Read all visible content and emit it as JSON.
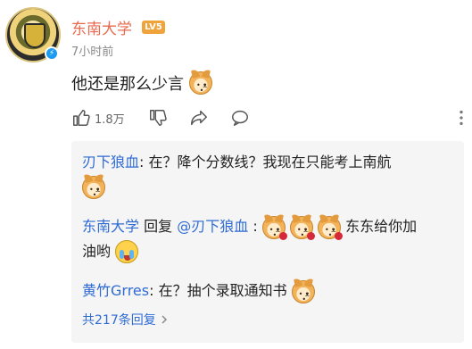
{
  "post": {
    "username": "东南大学",
    "level": "LV5",
    "time": "7小时前",
    "comment_text": "他还是那么少言",
    "comment_emoji": "doge-emoji"
  },
  "actions": {
    "like_count": "1.8万",
    "icons": [
      "thumbs-up-icon",
      "thumbs-down-icon",
      "share-icon",
      "comment-icon",
      "more-icon"
    ]
  },
  "replies": [
    {
      "author": "刃下狼血",
      "text": "在？降个分数线？我现在只能考上南航",
      "emojis": [
        "doge-emoji"
      ]
    },
    {
      "author": "东南大学",
      "reply_word": "回复",
      "mention": "@刃下狼血",
      "colon": ":",
      "text_a": "东东给你加",
      "text_b": "油哟",
      "emojis": [
        "doge-rose-emoji",
        "doge-rose-emoji",
        "doge-rose-emoji",
        "cry-emoji"
      ]
    },
    {
      "author": "黄竹Grres",
      "text": "在？抽个录取通知书",
      "emojis": [
        "doge-emoji"
      ]
    }
  ],
  "reply_total": "共217条回复"
}
